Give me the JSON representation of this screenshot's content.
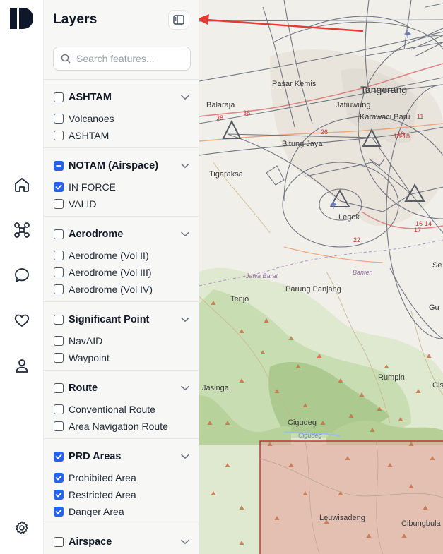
{
  "panel": {
    "title": "Layers",
    "search_placeholder": "Search features..."
  },
  "groups": [
    {
      "label": "ASHTAM",
      "state": "unchecked",
      "items": [
        {
          "label": "Volcanoes",
          "checked": false
        },
        {
          "label": "ASHTAM",
          "checked": false
        }
      ]
    },
    {
      "label": "NOTAM (Airspace)",
      "state": "mixed",
      "items": [
        {
          "label": "IN FORCE",
          "checked": true
        },
        {
          "label": "VALID",
          "checked": false
        }
      ]
    },
    {
      "label": "Aerodrome",
      "state": "unchecked",
      "items": [
        {
          "label": "Aerodrome (Vol II)",
          "checked": false
        },
        {
          "label": "Aerodrome (Vol III)",
          "checked": false
        },
        {
          "label": "Aerodrome (Vol IV)",
          "checked": false
        }
      ]
    },
    {
      "label": "Significant Point",
      "state": "unchecked",
      "items": [
        {
          "label": "NavAID",
          "checked": false
        },
        {
          "label": "Waypoint",
          "checked": false
        }
      ]
    },
    {
      "label": "Route",
      "state": "unchecked",
      "items": [
        {
          "label": "Conventional Route",
          "checked": false
        },
        {
          "label": "Area Navigation Route",
          "checked": false
        }
      ]
    },
    {
      "label": "PRD Areas",
      "state": "checked",
      "items": [
        {
          "label": "Prohibited Area",
          "checked": true
        },
        {
          "label": "Restricted Area",
          "checked": true
        },
        {
          "label": "Danger Area",
          "checked": true
        }
      ]
    },
    {
      "label": "Airspace",
      "state": "unchecked",
      "items": []
    }
  ],
  "rail": {
    "logo_icon": "app-logo-icon",
    "nav": [
      "home-icon",
      "drone-icon",
      "chat-icon",
      "heart-icon",
      "user-icon"
    ],
    "bottom": "settings-icon"
  },
  "map": {
    "labels": [
      {
        "text": "Pasar Kemis",
        "style": ""
      },
      {
        "text": "Tangerang",
        "style": "big"
      },
      {
        "text": "Balaraja",
        "style": ""
      },
      {
        "text": "Jatiuwung",
        "style": ""
      },
      {
        "text": "Karawaci Baru",
        "style": ""
      },
      {
        "text": "Bitung Jaya",
        "style": ""
      },
      {
        "text": "Tigaraksa",
        "style": ""
      },
      {
        "text": "Legok",
        "style": ""
      },
      {
        "text": "Banten",
        "style": "region"
      },
      {
        "text": "Jawa Barat",
        "style": "region"
      },
      {
        "text": "Parung Panjang",
        "style": ""
      },
      {
        "text": "Tenjo",
        "style": ""
      },
      {
        "text": "Jasinga",
        "style": ""
      },
      {
        "text": "Rumpin",
        "style": ""
      },
      {
        "text": "Cigudeg",
        "style": ""
      },
      {
        "text": "Cigudeg",
        "style": "water"
      },
      {
        "text": "Leuwisadeng",
        "style": ""
      },
      {
        "text": "Cibungbula",
        "style": ""
      },
      {
        "text": "Se",
        "style": ""
      },
      {
        "text": "Gu",
        "style": ""
      },
      {
        "text": "Cis",
        "style": ""
      }
    ],
    "road_numbers": [
      "38",
      "36",
      "26",
      "18",
      "11",
      "18-18",
      "17",
      "16-14",
      "22"
    ]
  },
  "colors": {
    "accent": "#2563eb",
    "restricted_area_fill": "#e8a5a0",
    "restricted_area_border": "#c0282d",
    "annotation_arrow": "#e53935"
  }
}
